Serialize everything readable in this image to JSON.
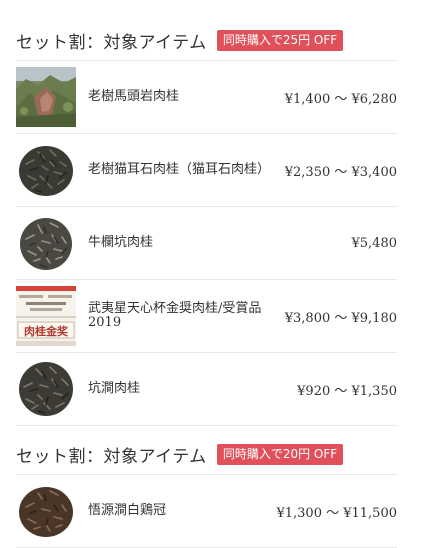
{
  "sections": [
    {
      "title": "セット割：対象アイテム",
      "badge": "同時購入で25円 OFF",
      "items": [
        {
          "name": "老樹馬頭岩肉桂",
          "price": "¥1,400 〜 ¥6,280",
          "image": "mountain-photo"
        },
        {
          "name": "老樹猫耳石肉桂（猫耳石肉桂）",
          "price": "¥2,350 〜 ¥3,400",
          "image": "tea-leaves-dark"
        },
        {
          "name": "牛欄坑肉桂",
          "price": "¥5,480",
          "image": "tea-leaves-grey"
        },
        {
          "name": "武夷星天心杯金奨肉桂/受賞品 2019",
          "price": "¥3,800 〜 ¥9,180",
          "image": "award-certificate",
          "image_text": "肉桂金奖"
        },
        {
          "name": "坑澗肉桂",
          "price": "¥920 〜 ¥1,350",
          "image": "tea-leaves-dark"
        }
      ]
    },
    {
      "title": "セット割：対象アイテム",
      "badge": "同時購入で20円 OFF",
      "items": [
        {
          "name": "悟源澗白鶏冠",
          "price": "¥1,300 〜 ¥11,500",
          "image": "tea-leaves-brown"
        }
      ]
    }
  ]
}
